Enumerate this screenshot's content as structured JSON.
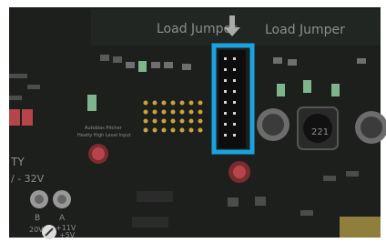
{
  "board": {
    "label_left": "Load Jumper",
    "label_right": "Load Jumper",
    "left_edge_marks": [
      "TY",
      "/ - 32V",
      "B",
      "A",
      "20V",
      "+11V",
      "+5V"
    ],
    "small_text_lines": [
      "Autobias Pitcher",
      "Heatly High Level Input"
    ],
    "inductor_text": "221"
  },
  "colors": {
    "pcb": "#1c1f1c",
    "highlight_box": "#1aa3e0",
    "silkscreen": "#8d8d8d",
    "gold_pad": "#c8a23a",
    "capacitor_red": "#b6454b",
    "green_component": "#7fb58c"
  },
  "icons": {
    "arrow": "arrow-down-icon"
  }
}
